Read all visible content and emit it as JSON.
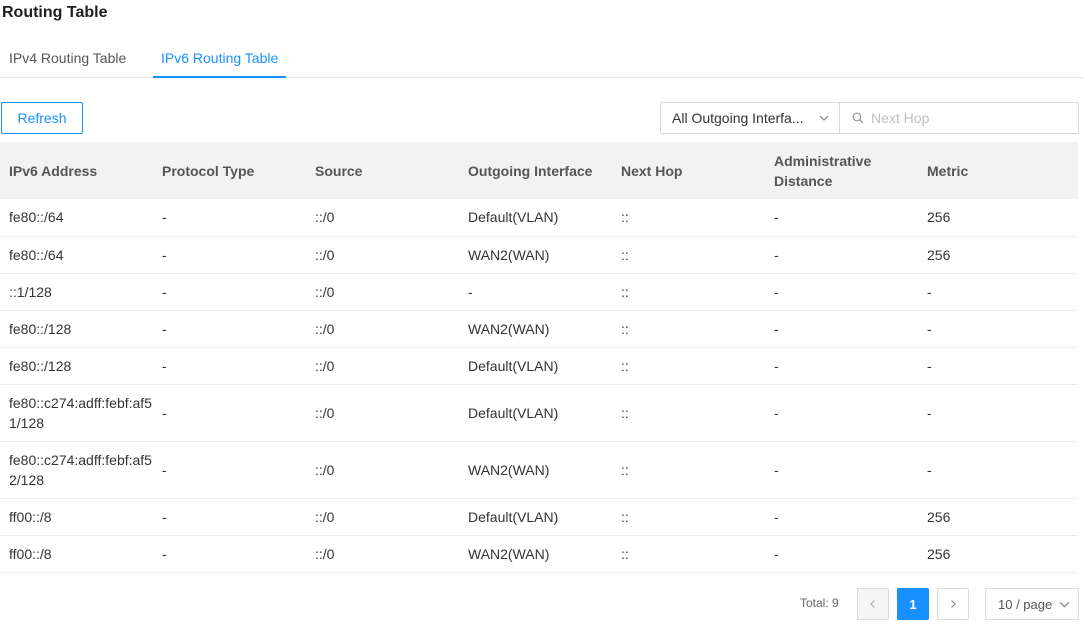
{
  "page": {
    "title": "Routing Table"
  },
  "tabs": [
    {
      "label": "IPv4 Routing Table",
      "active": false
    },
    {
      "label": "IPv6 Routing Table",
      "active": true
    }
  ],
  "toolbar": {
    "refresh_label": "Refresh"
  },
  "filter": {
    "interface_selected": "All Outgoing Interfa...",
    "search_placeholder": "Next Hop",
    "icons": {
      "dropdown": "chevron-down-icon",
      "search": "search-icon"
    }
  },
  "table": {
    "columns": [
      "IPv6 Address",
      "Protocol Type",
      "Source",
      "Outgoing Interface",
      "Next Hop",
      "Administrative Distance",
      "Metric"
    ],
    "rows": [
      [
        "fe80::/64",
        "-",
        "::/0",
        "Default(VLAN)",
        "::",
        "-",
        "256"
      ],
      [
        "fe80::/64",
        "-",
        "::/0",
        "WAN2(WAN)",
        "::",
        "-",
        "256"
      ],
      [
        "::1/128",
        "-",
        "::/0",
        "-",
        "::",
        "-",
        "-"
      ],
      [
        "fe80::/128",
        "-",
        "::/0",
        "WAN2(WAN)",
        "::",
        "-",
        "-"
      ],
      [
        "fe80::/128",
        "-",
        "::/0",
        "Default(VLAN)",
        "::",
        "-",
        "-"
      ],
      [
        "fe80::c274:adff:febf:af51/128",
        "-",
        "::/0",
        "Default(VLAN)",
        "::",
        "-",
        "-"
      ],
      [
        "fe80::c274:adff:febf:af52/128",
        "-",
        "::/0",
        "WAN2(WAN)",
        "::",
        "-",
        "-"
      ],
      [
        "ff00::/8",
        "-",
        "::/0",
        "Default(VLAN)",
        "::",
        "-",
        "256"
      ],
      [
        "ff00::/8",
        "-",
        "::/0",
        "WAN2(WAN)",
        "::",
        "-",
        "256"
      ]
    ]
  },
  "pagination": {
    "total_label": "Total: 9",
    "current_page": "1",
    "page_size": "10 / page"
  },
  "colors": {
    "accent": "#1890ff",
    "header_bg": "#f2f2f2",
    "border": "#d9d9d9"
  }
}
